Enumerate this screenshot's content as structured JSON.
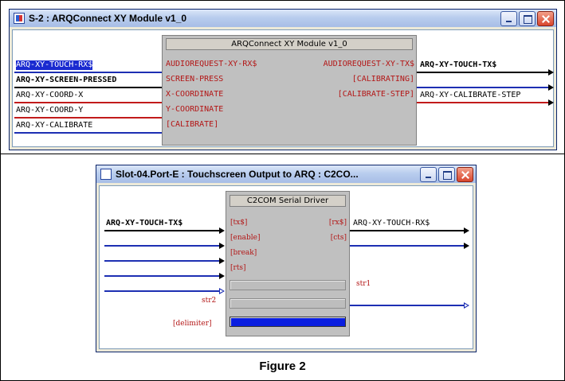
{
  "window1": {
    "title": "S-2 : ARQConnect XY Module v1_0",
    "module_title": "ARQConnect XY Module v1_0",
    "inputs": [
      {
        "signal": "ARQ-XY-TOUCH-RX$",
        "pin": "AUDIOREQUEST-XY-RX$"
      },
      {
        "signal": "ARQ-XY-SCREEN-PRESSED",
        "pin": "SCREEN-PRESS"
      },
      {
        "signal": "ARQ-XY-COORD-X",
        "pin": "X-COORDINATE"
      },
      {
        "signal": "ARQ-XY-COORD-Y",
        "pin": "Y-COORDINATE"
      },
      {
        "signal": "ARQ-XY-CALIBRATE",
        "pin": "[CALIBRATE]"
      }
    ],
    "outputs": [
      {
        "pin": "AUDIOREQUEST-XY-TX$",
        "signal": "ARQ-XY-TOUCH-TX$"
      },
      {
        "pin": "[CALIBRATING]",
        "signal": ""
      },
      {
        "pin": "[CALIBRATE-STEP]",
        "signal": "ARQ-XY-CALIBRATE-STEP"
      }
    ]
  },
  "window2": {
    "title": "Slot-04.Port-E : Touchscreen Output to ARQ : C2CO...",
    "module_title": "C2COM Serial Driver",
    "inputs": [
      {
        "signal": "ARQ-XY-TOUCH-TX$",
        "pin": "[tx$]"
      },
      {
        "signal": "",
        "pin": "[enable]"
      },
      {
        "signal": "",
        "pin": "[break]"
      },
      {
        "signal": "",
        "pin": "[rts]"
      }
    ],
    "outputs": [
      {
        "pin": "[rx$]",
        "signal": "ARQ-XY-TOUCH-RX$"
      },
      {
        "pin": "[cts]",
        "signal": ""
      }
    ],
    "param_left_label": "str2",
    "param_right_label": "str1",
    "delimiter_label": "[delimiter]"
  },
  "caption": "Figure 2",
  "colors": {
    "pin_text": "#b31616",
    "wire_blue": "#1d2fb3",
    "wire_red": "#c21b1b",
    "selection": "#1a2ad0",
    "delimiter_fill": "#0a1ee0"
  }
}
